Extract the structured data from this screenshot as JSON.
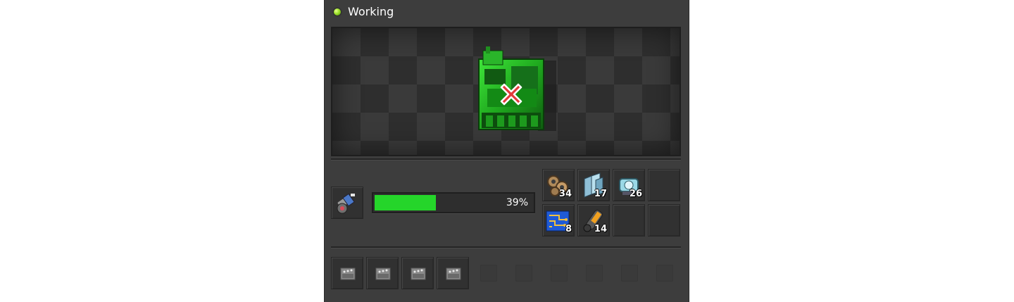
{
  "status": {
    "text": "Working",
    "color": "#8fd62a"
  },
  "preview": {
    "entity_icon": "assembling-machine-icon",
    "overlay_icon": "red-x-icon"
  },
  "recipe": {
    "icon": "flamethrower-turret-recipe-icon"
  },
  "progress": {
    "value": 0.39,
    "label": "39%",
    "fill_color": "#25d52a"
  },
  "inputs": [
    {
      "icon": "iron-gear-wheel-icon",
      "count": "34"
    },
    {
      "icon": "steel-plate-icon",
      "count": "17"
    },
    {
      "icon": "electric-engine-icon",
      "count": "26"
    },
    {
      "icon": "empty-slot",
      "count": ""
    },
    {
      "icon": "electronic-circuit-icon",
      "count": "8"
    },
    {
      "icon": "pipe-icon",
      "count": "14"
    },
    {
      "icon": "empty-slot",
      "count": ""
    },
    {
      "icon": "empty-slot",
      "count": ""
    }
  ],
  "module_slots": [
    {
      "icon": "module-slot-icon"
    },
    {
      "icon": "module-slot-icon"
    },
    {
      "icon": "module-slot-icon"
    },
    {
      "icon": "module-slot-icon"
    }
  ],
  "empty_slot_count": 6
}
